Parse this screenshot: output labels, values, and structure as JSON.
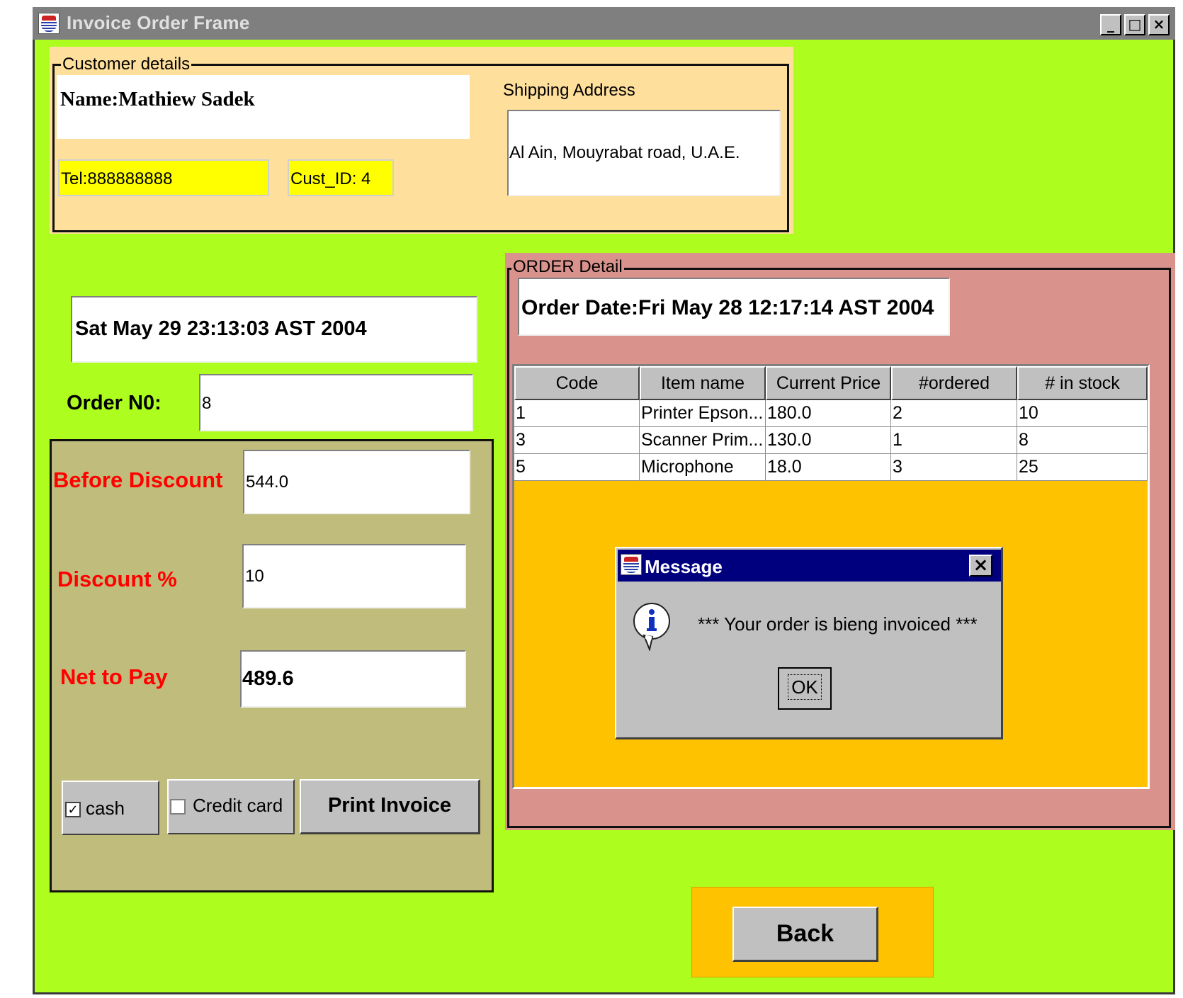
{
  "window": {
    "title": "Invoice Order Frame",
    "controls": {
      "minimize": "_",
      "maximize": "□",
      "close": "×"
    }
  },
  "customer": {
    "legend": "Customer details",
    "name": "Name:Mathiew Sadek",
    "tel": "Tel:888888888",
    "cust_id": "Cust_ID: 4",
    "shipping_label": "Shipping Address",
    "shipping_address": "Al Ain, Mouyrabat road, U.A.E."
  },
  "left": {
    "current_date": "Sat May 29 23:13:03 AST 2004",
    "order_no_label": "Order N0:",
    "order_no_value": "8",
    "before_discount_label": "Before Discount",
    "before_discount_value": "544.0",
    "discount_label": "Discount %",
    "discount_value": "10",
    "net_label": "Net to Pay",
    "net_value": "489.6",
    "cash_label": "cash",
    "cash_checked": true,
    "credit_label": "Credit card",
    "credit_checked": false,
    "print_label": "Print Invoice"
  },
  "order": {
    "legend": "ORDER Detail",
    "order_date": "Order Date:Fri May 28 12:17:14 AST 2004",
    "columns": [
      "Code",
      "Item name",
      "Current Price",
      "#ordered",
      "# in stock"
    ],
    "rows": [
      [
        "1",
        "Printer Epson...",
        "180.0",
        "2",
        "10"
      ],
      [
        "3",
        "Scanner Prim...",
        "130.0",
        "1",
        "8"
      ],
      [
        "5",
        "Microphone",
        "18.0",
        "3",
        "25"
      ]
    ]
  },
  "dialog": {
    "title": "Message",
    "message": "*** Your order is bieng invoiced ***",
    "ok_label": "OK",
    "close_glyph": "×"
  },
  "back_label": "Back",
  "colors": {
    "frame_bg": "#adfd1e",
    "customer_bg": "#fedf9c",
    "payment_bg": "#c0bd7c",
    "order_bg": "#d9928c",
    "table_bg": "#fec200",
    "label_red": "#ff0000",
    "dialog_title": "#00007f"
  }
}
